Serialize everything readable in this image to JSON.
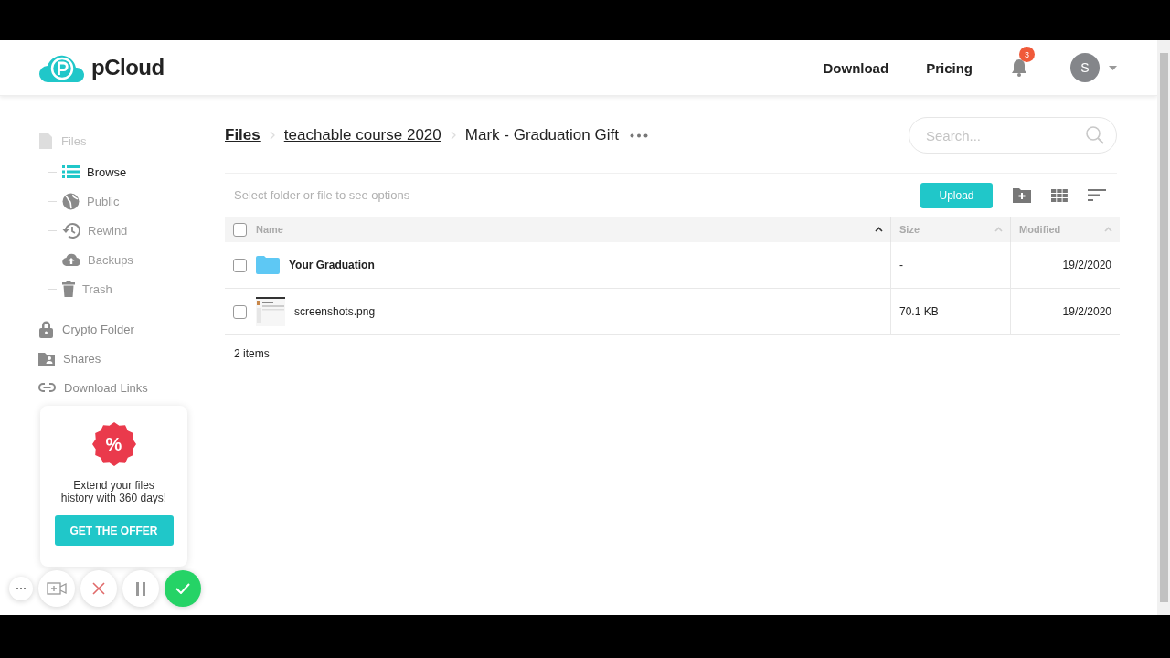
{
  "header": {
    "logo": "pCloud",
    "nav": [
      "Download",
      "Pricing"
    ],
    "notification_count": "3",
    "avatar": "S"
  },
  "sidebar": {
    "items": [
      {
        "label": "Files",
        "children": [
          {
            "label": "Browse",
            "selected": true
          },
          {
            "label": "Public",
            "selected": false
          },
          {
            "label": "Rewind",
            "selected": false
          },
          {
            "label": "Backups",
            "selected": false
          },
          {
            "label": "Trash",
            "selected": false
          }
        ]
      },
      {
        "label": "Crypto Folder"
      },
      {
        "label": "Shares"
      },
      {
        "label": "Download Links"
      }
    ]
  },
  "breadcrumb": [
    {
      "label": "Files",
      "kind": "root"
    },
    {
      "label": "teachable course 2020",
      "kind": "link"
    },
    {
      "label": "Mark - Graduation Gift",
      "kind": "current"
    }
  ],
  "search": {
    "placeholder": "Search..."
  },
  "toolbar": {
    "hint": "Select folder or file to see options",
    "upload": "Upload"
  },
  "table": {
    "select_all_checked": false,
    "columns": [
      {
        "label": "Name",
        "sorted": true
      },
      {
        "label": "Size",
        "sorted": false
      },
      {
        "label": "Modified",
        "sorted": false
      }
    ],
    "rows": [
      {
        "kind": "folder",
        "name": "Your Graduation",
        "size": "-",
        "modified": "19/2/2020",
        "checked": false
      },
      {
        "kind": "image",
        "name": "screenshots.png",
        "size": "70.1 KB",
        "modified": "19/2/2020",
        "checked": false
      }
    ],
    "footer": "2 items"
  },
  "promo": {
    "badge": "%",
    "text": "Extend your files history with 360 days!",
    "button": "GET THE OFFER"
  }
}
